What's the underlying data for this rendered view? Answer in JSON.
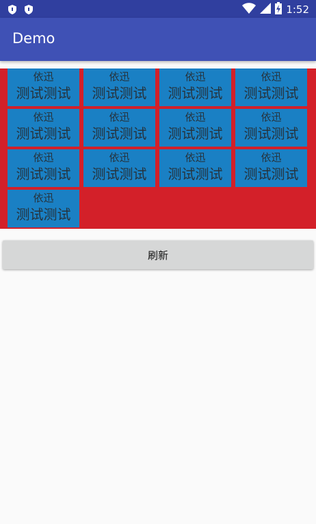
{
  "status_bar": {
    "time": "1:52",
    "icons": [
      "shield-icon",
      "shield-icon",
      "wifi-icon",
      "signal-icon",
      "battery-charging-icon"
    ]
  },
  "app_bar": {
    "title": "Demo"
  },
  "grid": {
    "background_color": "#d32029",
    "tile_color": "#1a80c4",
    "tiles": [
      {
        "top": "依迅",
        "bottom": "测试测试"
      },
      {
        "top": "依迅",
        "bottom": "测试测试"
      },
      {
        "top": "依迅",
        "bottom": "测试测试"
      },
      {
        "top": "依迅",
        "bottom": "测试测试"
      },
      {
        "top": "依迅",
        "bottom": "测试测试"
      },
      {
        "top": "依迅",
        "bottom": "测试测试"
      },
      {
        "top": "依迅",
        "bottom": "测试测试"
      },
      {
        "top": "依迅",
        "bottom": "测试测试"
      },
      {
        "top": "依迅",
        "bottom": "测试测试"
      },
      {
        "top": "依迅",
        "bottom": "测试测试"
      },
      {
        "top": "依迅",
        "bottom": "测试测试"
      },
      {
        "top": "依迅",
        "bottom": "测试测试"
      },
      {
        "top": "依迅",
        "bottom": "测试测试"
      }
    ]
  },
  "refresh_button": {
    "label": "刷新"
  }
}
